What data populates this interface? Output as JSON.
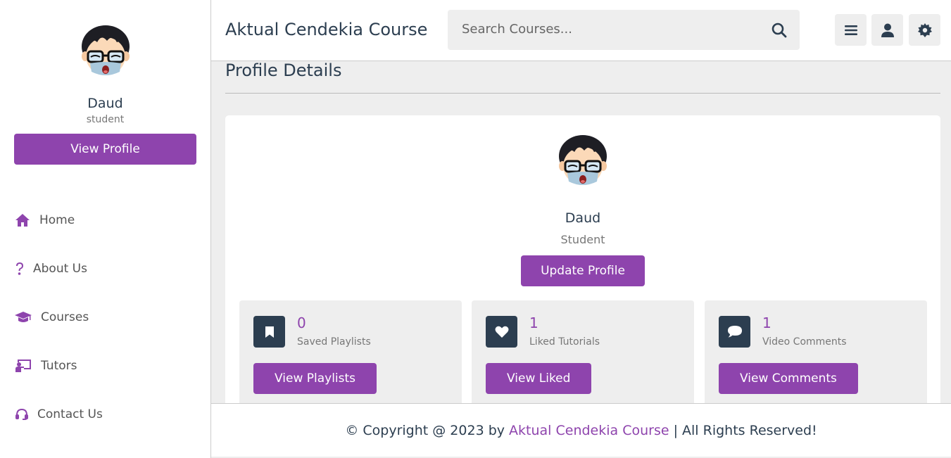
{
  "header": {
    "logo": "Aktual Cendekia Course",
    "search_placeholder": "Search Courses...",
    "icons": [
      "search-icon",
      "menu-icon",
      "user-icon",
      "settings-icon"
    ]
  },
  "sidebar": {
    "name": "Daud",
    "role": "student",
    "view_profile_label": "View Profile",
    "items": [
      {
        "label": "Home",
        "icon": "home-icon"
      },
      {
        "label": "About Us",
        "icon": "question-icon"
      },
      {
        "label": "Courses",
        "icon": "graduation-cap-icon"
      },
      {
        "label": "Tutors",
        "icon": "chalkboard-teacher-icon"
      },
      {
        "label": "Contact Us",
        "icon": "headset-icon"
      }
    ]
  },
  "main": {
    "heading": "Profile Details",
    "profile": {
      "name": "Daud",
      "role": "Student",
      "update_label": "Update Profile"
    },
    "stats": [
      {
        "count": "0",
        "label": "Saved Playlists",
        "button": "View Playlists",
        "icon": "bookmark-icon"
      },
      {
        "count": "1",
        "label": "Liked Tutorials",
        "button": "View Liked",
        "icon": "heart-icon"
      },
      {
        "count": "1",
        "label": "Video Comments",
        "button": "View Comments",
        "icon": "comment-icon"
      }
    ]
  },
  "footer": {
    "prefix": "© Copyright @ 2023 by ",
    "brand": "Aktual Cendekia Course",
    "suffix": " | All Rights Reserved!"
  },
  "colors": {
    "accent": "#8e44ad",
    "dark": "#2c3e50",
    "background": "#eeeeee"
  }
}
